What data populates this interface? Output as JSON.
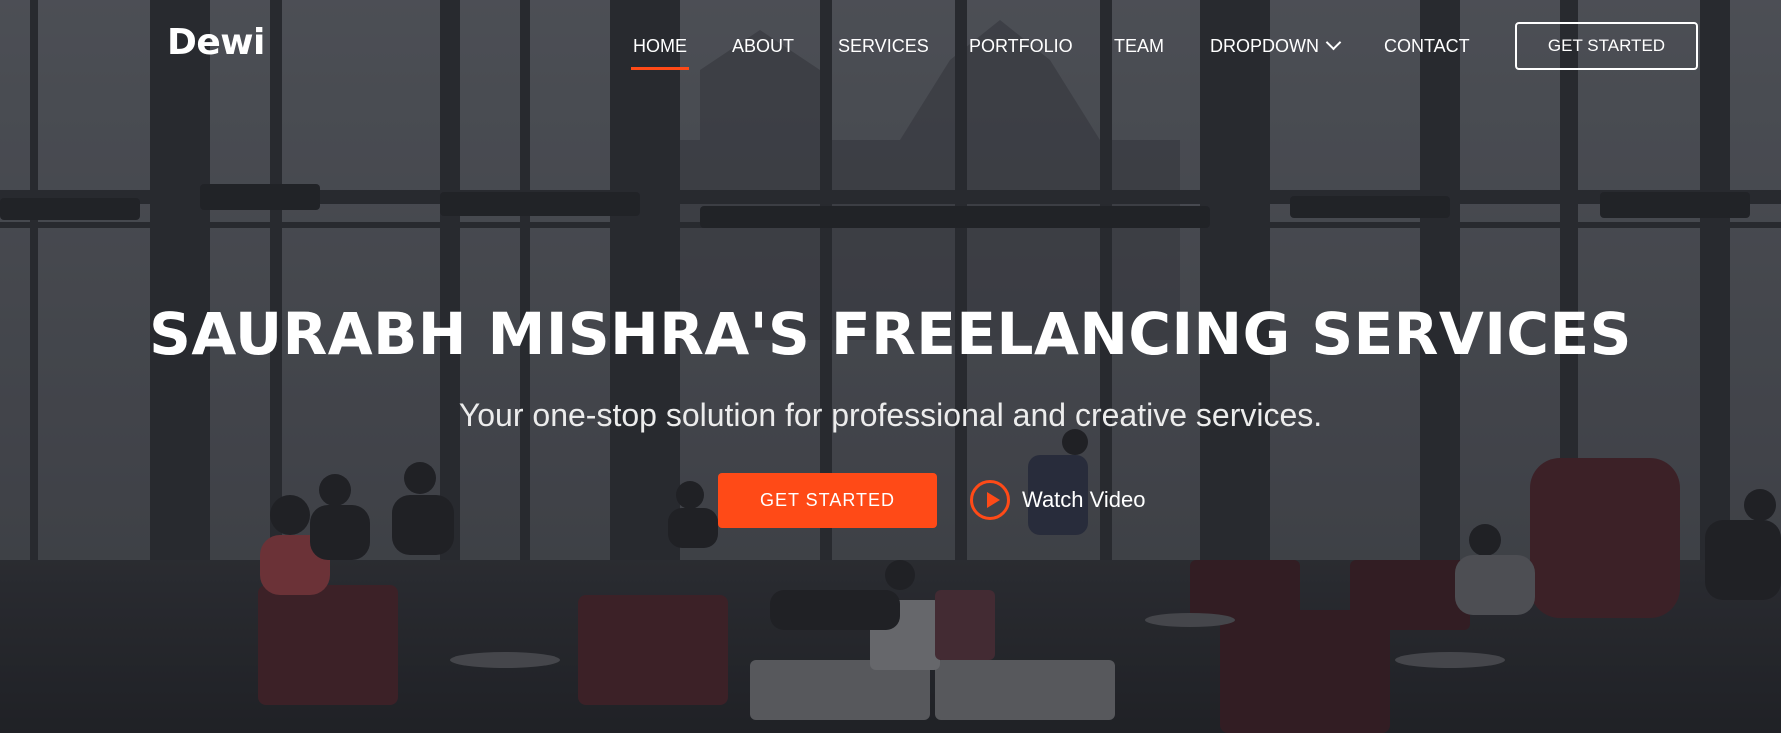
{
  "brand": {
    "logo": "Dewi"
  },
  "nav": {
    "items": [
      {
        "label": "HOME"
      },
      {
        "label": "ABOUT"
      },
      {
        "label": "SERVICES"
      },
      {
        "label": "PORTFOLIO"
      },
      {
        "label": "TEAM"
      },
      {
        "label": "DROPDOWN"
      },
      {
        "label": "CONTACT"
      }
    ],
    "active": "HOME",
    "cta_label": "GET STARTED"
  },
  "hero": {
    "title": "SAURABH MISHRA'S FREELANCING SERVICES",
    "subtitle": "Your one-stop solution for professional and creative services.",
    "primary_button": "GET STARTED",
    "video_link": "Watch Video"
  },
  "colors": {
    "accent": "#ff4a17",
    "overlay": "#14161c"
  },
  "icons": {
    "dropdown": "chevron-down-icon",
    "play": "play-circle-icon"
  }
}
